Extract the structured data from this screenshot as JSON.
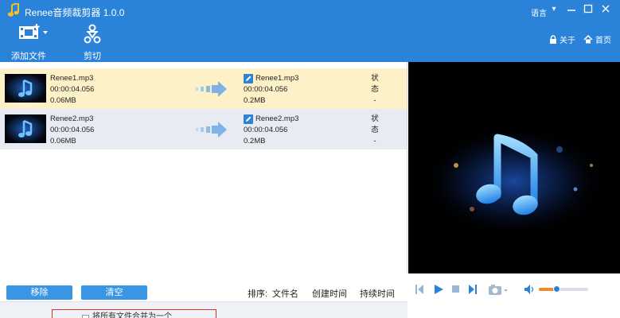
{
  "window": {
    "title": "Renee音频裁剪器 1.0.0",
    "language_label": "语言",
    "minimize_label": "—",
    "maximize_label": "☐",
    "close_label": "✕",
    "menu_label": "▾"
  },
  "toolbar": {
    "add_file_label": "添加文件",
    "cut_label": "剪切",
    "about_label": "关于",
    "home_label": "首页"
  },
  "files": [
    {
      "name": "Renee1.mp3",
      "duration": "00:00:04.056",
      "size": "0.06MB",
      "output_name": "Renee1.mp3",
      "output_duration": "00:00:04.056",
      "output_size": "0.2MB",
      "status_label": "状态",
      "status_value": "-"
    },
    {
      "name": "Renee2.mp3",
      "duration": "00:00:04.056",
      "size": "0.06MB",
      "output_name": "Renee2.mp3",
      "output_duration": "00:00:04.056",
      "output_size": "0.2MB",
      "status_label": "状态",
      "status_value": "-"
    }
  ],
  "controls": {
    "remove_label": "移除",
    "clear_label": "清空",
    "sort_label": "排序:",
    "sort_filename": "文件名",
    "sort_created": "创建时间",
    "sort_duration": "持续时间"
  },
  "options": {
    "merge_label": "将所有文件合并为一个"
  },
  "player": {
    "volume_fraction": 0.35
  },
  "colors": {
    "accent": "#2b83d9",
    "button": "#3a95e5",
    "selected_row": "#fdf1c7",
    "alt_row": "#e8ecf2",
    "volume": "#f08a2c"
  }
}
